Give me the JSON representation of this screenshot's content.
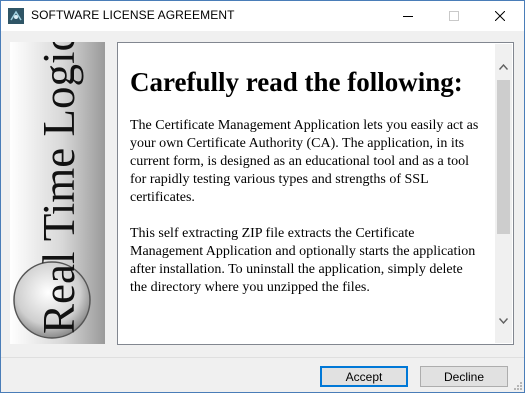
{
  "window": {
    "title": "SOFTWARE LICENSE AGREEMENT"
  },
  "logo": {
    "text": "Real Time Logic"
  },
  "content": {
    "heading": "Carefully read the following:",
    "paragraphs": [
      "The Certificate Management Application lets you easily act as your own Certificate Authority (CA). The application, in its current form, is designed as an educational tool and as a tool for rapidly testing various types and strengths of SSL certificates.",
      "This self extracting ZIP file extracts the Certificate Management Application and optionally starts the application after installation. To uninstall the application, simply delete the directory where you unzipped the files."
    ]
  },
  "buttons": {
    "accept": "Accept",
    "decline": "Decline"
  },
  "colors": {
    "accent": "#0078d7",
    "border": "#828790",
    "face": "#f0f0f0"
  }
}
